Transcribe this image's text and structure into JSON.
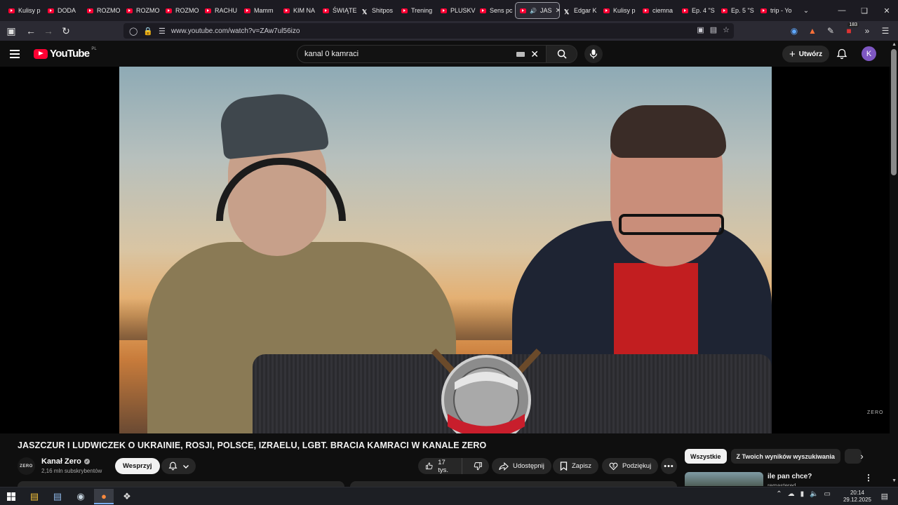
{
  "browser": {
    "tabs": [
      {
        "label": "Kulisy p",
        "icon": "youtube-icon"
      },
      {
        "label": "DODA",
        "icon": "youtube-icon"
      },
      {
        "label": "ROZMO",
        "icon": "youtube-icon"
      },
      {
        "label": "ROZMO",
        "icon": "youtube-icon"
      },
      {
        "label": "ROZMO",
        "icon": "youtube-icon"
      },
      {
        "label": "RACHU",
        "icon": "youtube-icon"
      },
      {
        "label": "Mamm",
        "icon": "youtube-icon"
      },
      {
        "label": "KIM NA",
        "icon": "youtube-icon"
      },
      {
        "label": "ŚWIĄTE",
        "icon": "youtube-icon"
      },
      {
        "label": "Shitpos",
        "icon": "x-icon"
      },
      {
        "label": "Trening",
        "icon": "youtube-icon"
      },
      {
        "label": "PLUSKV",
        "icon": "youtube-icon"
      },
      {
        "label": "Sens pc",
        "icon": "youtube-icon"
      },
      {
        "label": "JAS",
        "icon": "youtube-icon",
        "active": true
      },
      {
        "label": "Edgar K",
        "icon": "x-icon"
      },
      {
        "label": "Kulisy p",
        "icon": "youtube-icon"
      },
      {
        "label": "ciemna",
        "icon": "youtube-icon"
      },
      {
        "label": "Ep. 4 \"S",
        "icon": "youtube-icon"
      },
      {
        "label": "Ep. 5 \"S",
        "icon": "youtube-icon"
      },
      {
        "label": "trip - Yo",
        "icon": "youtube-icon"
      }
    ],
    "url": "www.youtube.com/watch?v=ZAw7ul56izo",
    "extension_badge": "183"
  },
  "youtube": {
    "logo_text": "YouTube",
    "region": "PL",
    "search_query": "kanal 0 kamraci",
    "create_label": "Utwórz",
    "avatar_letter": "K"
  },
  "video": {
    "watermark": "ZERO",
    "title": "JASZCZUR I LUDWICZEK O UKRAINIE, ROSJI, POLSCE, IZRAELU, LGBT. BRACIA KAMRACI W KANALE ZERO",
    "channel_logo_text": "ZERO",
    "channel_name": "Kanał Zero",
    "subscribers": "2,16 mln subskrybentów",
    "support_label": "Wesprzyj",
    "likes": "17 tys.",
    "share_label": "Udostępnij",
    "save_label": "Zapisz",
    "thanks_label": "Podziękuj"
  },
  "sidebar": {
    "chips": [
      "Wszystkie",
      "Z Twoich wyników wyszukiwania"
    ],
    "recommended": {
      "title": "ile pan chce?",
      "channel": "remastered"
    }
  },
  "taskbar": {
    "time": "20:14",
    "date": "29.12.2025"
  }
}
